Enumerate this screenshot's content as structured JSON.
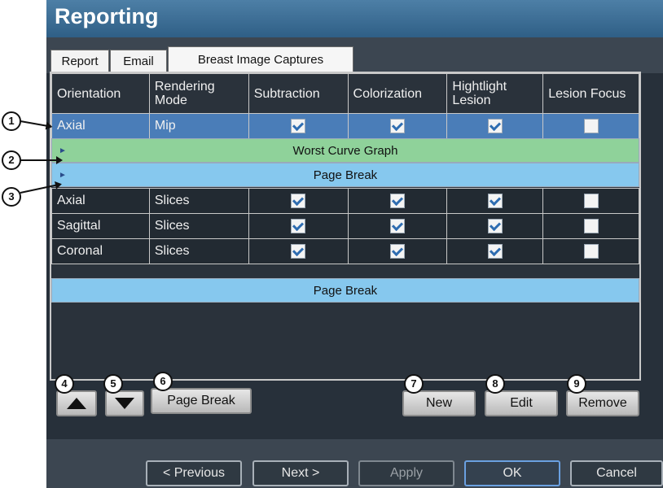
{
  "window": {
    "title": "Reporting"
  },
  "tabs": [
    {
      "label": "Report"
    },
    {
      "label": "Email"
    },
    {
      "label": "Breast Image Captures"
    }
  ],
  "table": {
    "columns": [
      "Orientation",
      "Rendering Mode",
      "Subtraction",
      "Colorization",
      "Hightlight Lesion",
      "Lesion Focus"
    ],
    "rows": [
      {
        "kind": "data",
        "orientation": "Axial",
        "mode": "Mip",
        "checks": [
          true,
          true,
          true,
          false
        ],
        "selected": true
      },
      {
        "kind": "full",
        "label": "Worst Curve Graph",
        "color": "#8fd29a"
      },
      {
        "kind": "full",
        "label": "Page Break",
        "color": "#86c8ee"
      },
      {
        "kind": "data",
        "orientation": "Axial",
        "mode": "Slices",
        "checks": [
          true,
          true,
          true,
          false
        ]
      },
      {
        "kind": "data",
        "orientation": "Sagittal",
        "mode": "Slices",
        "checks": [
          true,
          true,
          true,
          false
        ]
      },
      {
        "kind": "data",
        "orientation": "Coronal",
        "mode": "Slices",
        "checks": [
          true,
          true,
          true,
          false
        ]
      },
      {
        "kind": "full",
        "label": "Page Break",
        "color": "#86c8ee"
      }
    ]
  },
  "buttons": {
    "page_break": "Page Break",
    "new": "New",
    "edit": "Edit",
    "remove": "Remove",
    "previous": "< Previous",
    "next": "Next >",
    "apply": "Apply",
    "ok": "OK",
    "cancel": "Cancel"
  },
  "callouts": [
    "1",
    "2",
    "3",
    "4",
    "5",
    "6",
    "7",
    "8",
    "9"
  ],
  "icons": {
    "move_up": "triangle-up-icon",
    "move_down": "triangle-down-icon"
  }
}
